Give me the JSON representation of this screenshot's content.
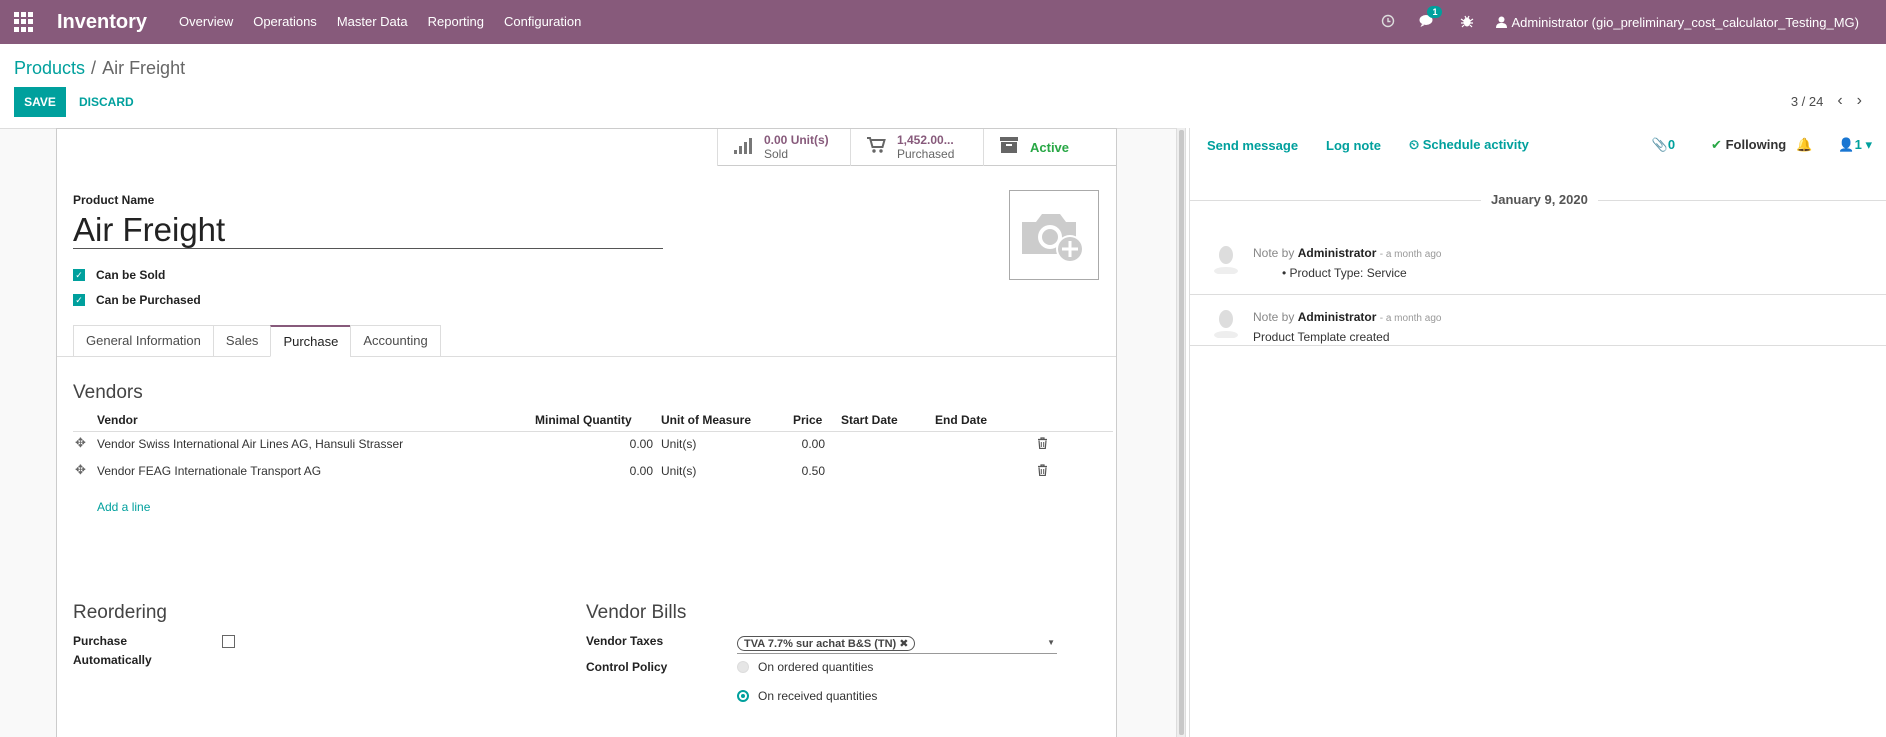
{
  "nav": {
    "app_name": "Inventory",
    "menus": [
      "Overview",
      "Operations",
      "Master Data",
      "Reporting",
      "Configuration"
    ],
    "messages_count": "1",
    "user": "Administrator (gio_preliminary_cost_calculator_Testing_MG)",
    "accent": "#875a7b"
  },
  "control": {
    "breadcrumb_parent": "Products",
    "breadcrumb_current": "Air Freight",
    "save_label": "SAVE",
    "discard_label": "DISCARD",
    "pager": "3 / 24"
  },
  "stats": {
    "sold_value": "0.00 Unit(s)",
    "sold_label": "Sold",
    "purchased_value": "1,452.00...",
    "purchased_label": "Purchased",
    "active_label": "Active"
  },
  "product": {
    "name_label": "Product Name",
    "name": "Air Freight",
    "can_be_sold": "Can be Sold",
    "can_be_purchased": "Can be Purchased"
  },
  "tabs": [
    "General Information",
    "Sales",
    "Purchase",
    "Accounting"
  ],
  "vendors": {
    "title": "Vendors",
    "headers": [
      "Vendor",
      "Minimal Quantity",
      "Unit of Measure",
      "Price",
      "Start Date",
      "End Date"
    ],
    "rows": [
      {
        "vendor": "Vendor Swiss International Air Lines AG, Hansuli Strasser",
        "min_qty": "0.00",
        "uom": "Unit(s)",
        "price": "0.00"
      },
      {
        "vendor": "Vendor FEAG Internationale Transport AG",
        "min_qty": "0.00",
        "uom": "Unit(s)",
        "price": "0.50"
      }
    ],
    "add_line": "Add a line"
  },
  "reordering": {
    "title": "Reordering",
    "purchase_auto_line1": "Purchase",
    "purchase_auto_line2": "Automatically"
  },
  "vendor_bills": {
    "title": "Vendor Bills",
    "taxes_label": "Vendor Taxes",
    "tax_tag": "TVA 7.7% sur achat B&S (TN)",
    "control_label": "Control Policy",
    "opt_ordered": "On ordered quantities",
    "opt_received": "On received quantities"
  },
  "chatter": {
    "send_message": "Send message",
    "log_note": "Log note",
    "schedule_activity": "Schedule activity",
    "attachments": "0",
    "following": "Following",
    "followers": "1",
    "date": "January 9, 2020",
    "messages": [
      {
        "prefix": "Note by",
        "author": "Administrator",
        "time": "- a month ago",
        "body": "Product Type: Service"
      },
      {
        "prefix": "Note by",
        "author": "Administrator",
        "time": "- a month ago",
        "body": "Product Template created"
      }
    ]
  }
}
